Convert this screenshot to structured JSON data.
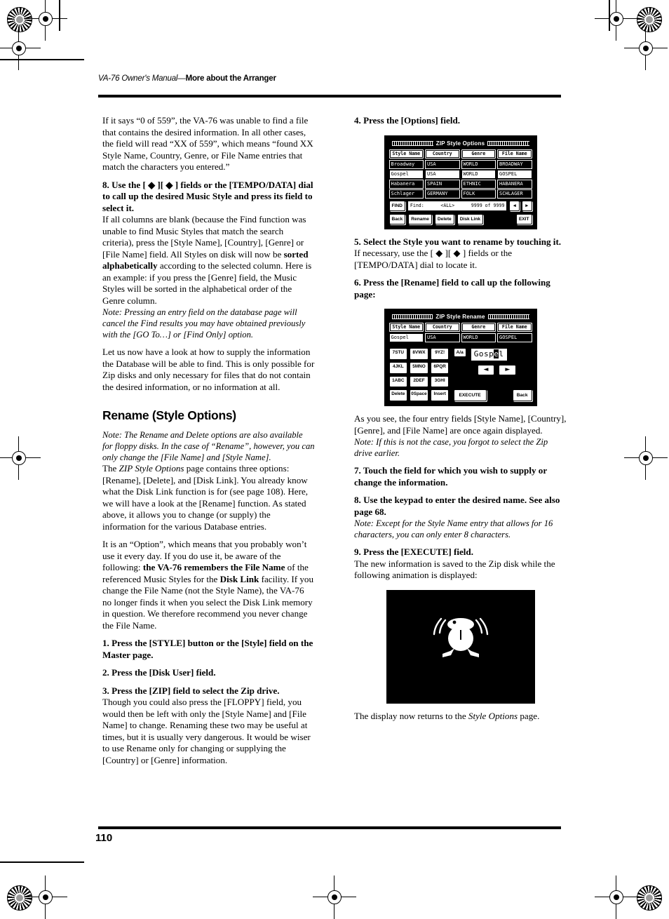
{
  "header": {
    "manual_title": "VA-76 Owner's Manual",
    "separator": "—",
    "section": "More about the Arranger"
  },
  "page_number": "110",
  "left_column": {
    "p1": "If it says “0 of 559”, the VA-76 was unable to find a file that contains the desired information. In all other cases, the field will read “XX of 559”, which means “found XX Style Name, Country, Genre, or File Name entries that match the characters you entered.”",
    "step8_bold": "8. Use the [ ◆ ][ ◆ ] fields or the [TEMPO/DATA] dial to call up the desired Music Style and press its field to select it.",
    "step8_body_a": "If all columns are blank (because the Find function was unable to find Music Styles that match the search criteria), press the [Style Name], [Country], [Genre] or [File Name] field. All Styles on disk will now be ",
    "step8_body_bold": "sorted alphabetically",
    "step8_body_b": " according to the selected column. Here is an example: if you press the [Genre] field, the Music Styles will be sorted in the alphabetical order of the Genre column.",
    "note1": "Note: Pressing an entry field on the database page will cancel the Find results you may have obtained previously with the [GO To…] or [Find Only] option.",
    "p2": "Let us now have a look at how to supply the information the Database will be able to find. This is only possible for Zip disks and only necessary for files that do not contain the desired information, or no information at all.",
    "heading": "Rename (Style Options)",
    "note2": "Note: The Rename and Delete options are also available for floppy disks. In the case of “Rename”, however, you can only change the [File Name] and [Style Name].",
    "p3_a": "The ",
    "p3_ital": "ZIP Style Options",
    "p3_b": " page contains three options: [Rename], [Delete], and [Disk Link]. You already know what the Disk Link function is for (see page 108). Here, we will have a look at the [Rename] function. As stated above, it allows you to change (or supply) the information for the various Database entries.",
    "p4_a": "It is an “Option”, which means that you probably won’t use it every day. If you do use it, be aware of the following: ",
    "p4_bold1": "the VA-76 remembers the File Name",
    "p4_b": " of the referenced Music Styles for the ",
    "p4_bold2": "Disk Link",
    "p4_c": " facility. If you change the File Name (not the Style Name), the VA-76 no longer finds it when you select the Disk Link memory in question. We therefore recommend you never change the File Name.",
    "step1": "1. Press the [STYLE] button or the [Style] field on the Master page.",
    "step2": "2. Press the [Disk User] field.",
    "step3_bold": "3. Press the [ZIP] field to select the Zip drive.",
    "step3_body": "Though you could also press the [FLOPPY] field, you would then be left with only the [Style Name] and [File Name] to change. Renaming these two may be useful at times, but it is usually very dangerous. It would be wiser to use Rename only for changing or supplying the [Country] or [Genre] information."
  },
  "right_column": {
    "step4": "4. Press the [Options] field.",
    "step5_bold": "5. Select the Style you want to rename by touching it.",
    "step5_body": "If necessary, use the [ ◆ ][ ◆ ] fields or the [TEMPO/DATA] dial to locate it.",
    "step6": "6. Press the [Rename] field to call up the following page:",
    "p_after": "As you see, the four entry fields [Style Name], [Country], [Genre], and [File Name] are once again displayed.",
    "note3": "Note: If this is not the case, you forgot to select the Zip drive earlier.",
    "step7": "7. Touch the field for which you wish to supply or change the information.",
    "step8": "8. Use the keypad to enter the desired name. See also page 68.",
    "note4": "Note: Except for the Style Name entry that allows for 16 characters, you can only enter 8 characters.",
    "step9_bold": "9. Press the [EXECUTE] field.",
    "step9_body": "The new information is saved to the Zip disk while the following animation is displayed:",
    "closing_a": "The display now returns to the ",
    "closing_ital": "Style Options",
    "closing_b": " page."
  },
  "lcd_options": {
    "title": "ZIP Style Options",
    "columns": [
      "Style Name",
      "Country",
      "Genre",
      "File Name"
    ],
    "rows": [
      [
        "Broadway",
        "USA",
        "WORLD",
        "BROADWAY"
      ],
      [
        "Gospel",
        "USA",
        "WORLD",
        "GOSPEL"
      ],
      [
        "Habanera",
        "SPAIN",
        "ETHNIC",
        "HABANERA"
      ],
      [
        "Schlager",
        "GERMANY",
        "FOLK",
        "SCHLAGER"
      ]
    ],
    "selected_row_index": 1,
    "find_icon_label": "FIND",
    "find_label": "Find:",
    "find_value": "<ALL>",
    "count": "9999 of 9999",
    "prev_arrow": "◄",
    "next_arrow": "►",
    "buttons": [
      "Back",
      "Rename",
      "Delete",
      "Disk Link",
      "EXIT"
    ]
  },
  "lcd_rename": {
    "title": "ZIP Style Rename",
    "columns": [
      "Style Name",
      "Country",
      "Genre",
      "File Name"
    ],
    "row": [
      "Gospel",
      "USA",
      "WORLD",
      "GOSPEL"
    ],
    "keys": [
      {
        "num": "7",
        "letters": "STU"
      },
      {
        "num": "8",
        "letters": "VWX"
      },
      {
        "num": "9",
        "letters": "YZ!"
      },
      {
        "num": "4",
        "letters": "JKL"
      },
      {
        "num": "5",
        "letters": "MNO"
      },
      {
        "num": "6",
        "letters": "PQR"
      },
      {
        "num": "1",
        "letters": "ABC"
      },
      {
        "num": "2",
        "letters": "DEF"
      },
      {
        "num": "3",
        "letters": "GHI"
      },
      {
        "num": "",
        "letters": "Delete"
      },
      {
        "num": "0",
        "letters": "Space"
      },
      {
        "num": "",
        "letters": "Insert"
      }
    ],
    "case_toggle": "A/a",
    "name_before": "Gosp",
    "name_cursor": "e",
    "name_after": "l",
    "left_arrow": "◄",
    "right_arrow": "►",
    "execute": "EXECUTE",
    "back": "Back"
  },
  "animation": {
    "description": "shaking-character-animation"
  }
}
